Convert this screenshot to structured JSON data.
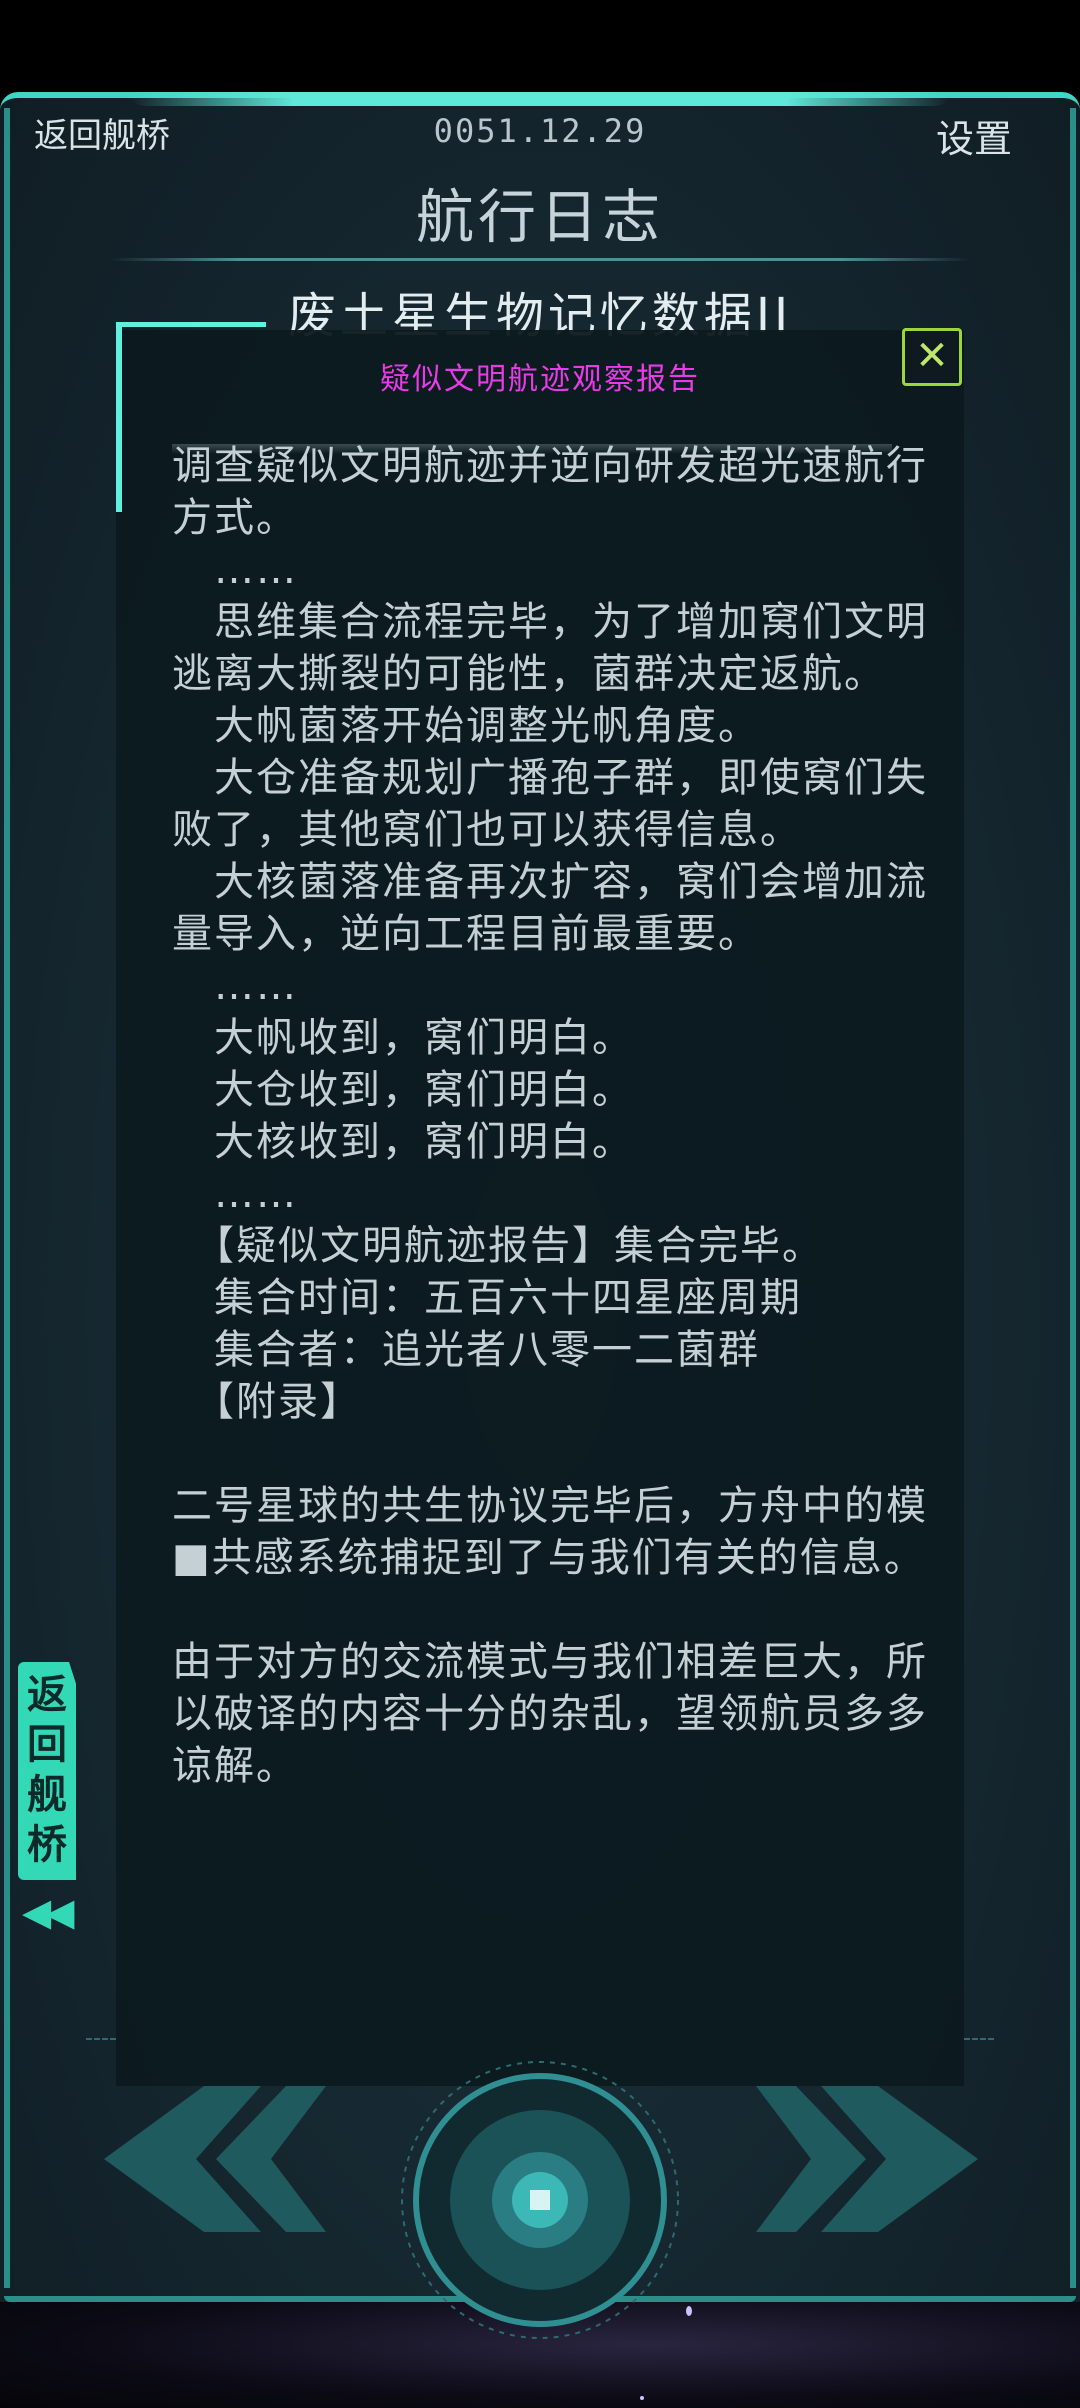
{
  "header": {
    "back_label": "返回舰桥",
    "date": "0051.12.29",
    "settings_label": "设置"
  },
  "page_title": "航行日志",
  "subtitle": "废土星生物记忆数据II",
  "dialog": {
    "title": "疑似文明航迹观察报告",
    "close_label": "✕",
    "paragraphs": [
      "调查疑似文明航迹并逆向研发超光速航行方式。",
      "　……",
      "　思维集合流程完毕，为了增加窝们文明逃离大撕裂的可能性，菌群决定返航。",
      "　大帆菌落开始调整光帆角度。",
      "　大仓准备规划广播孢子群，即使窝们失败了，其他窝们也可以获得信息。",
      "　大核菌落准备再次扩容，窝们会增加流量导入，逆向工程目前最重要。",
      "　……",
      "　大帆收到，窝们明白。",
      "　大仓收到，窝们明白。",
      "　大核收到，窝们明白。",
      "　……",
      "　【疑似文明航迹报告】集合完毕。",
      "　集合时间：五百六十四星座周期",
      "　集合者：追光者八零一二菌群",
      "　【附录】",
      "",
      "二号星球的共生协议完毕后，方舟中的模■共感系统捕捉到了与我们有关的信息。",
      "",
      "由于对方的交流模式与我们相差巨大，所以破译的内容十分的杂乱，望领航员多多谅解。"
    ]
  },
  "side_tab": {
    "label": "返回舰桥",
    "arrow": "◀◀"
  },
  "colors": {
    "accent": "#33d9b6",
    "dialog_title": "#e83be5",
    "close_border": "#9bd63b"
  },
  "icons": {
    "close": "close-icon",
    "prev": "double-chevron-left-icon",
    "next": "double-chevron-right-icon",
    "dial": "center-dial-icon"
  }
}
